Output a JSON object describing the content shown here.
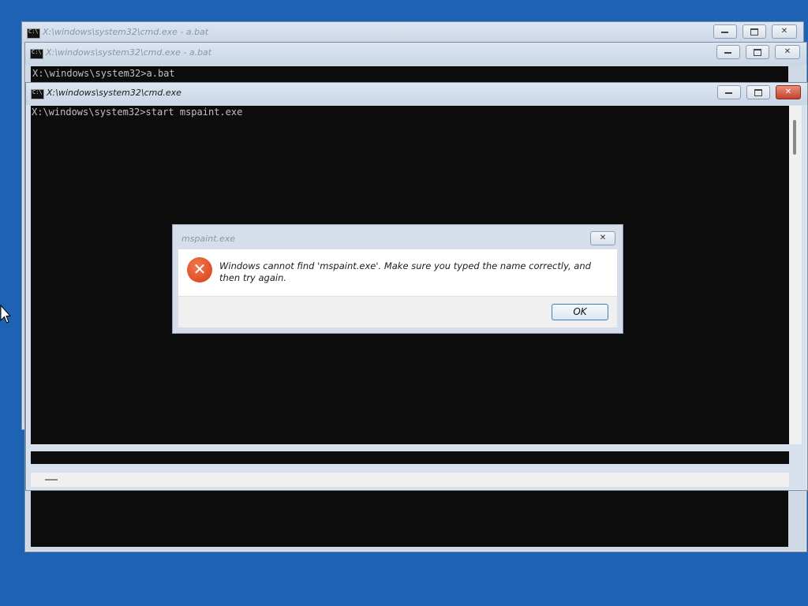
{
  "windows": [
    {
      "title": "X:\\windows\\system32\\cmd.exe - a.bat",
      "console_text": "",
      "icon": "cmd-icon"
    },
    {
      "title": "X:\\windows\\system32\\cmd.exe - a.bat",
      "console_text": "X:\\windows\\system32>a.bat",
      "icon": "cmd-icon"
    },
    {
      "title": "X:\\windows\\system32\\cmd.exe",
      "console_text": "X:\\windows\\system32>start mspaint.exe",
      "icon": "cmd-icon"
    }
  ],
  "dialog": {
    "title": "mspaint.exe",
    "message": "Windows cannot find 'mspaint.exe'. Make sure you typed the name correctly, and then try again.",
    "ok_label": "OK",
    "icon": "error-icon"
  },
  "glyphs": {
    "close": "✕",
    "error": "✕"
  },
  "colors": {
    "desktop": "#1e63b3",
    "console_bg": "#0c0c0c",
    "error_icon": "#d83b14"
  }
}
